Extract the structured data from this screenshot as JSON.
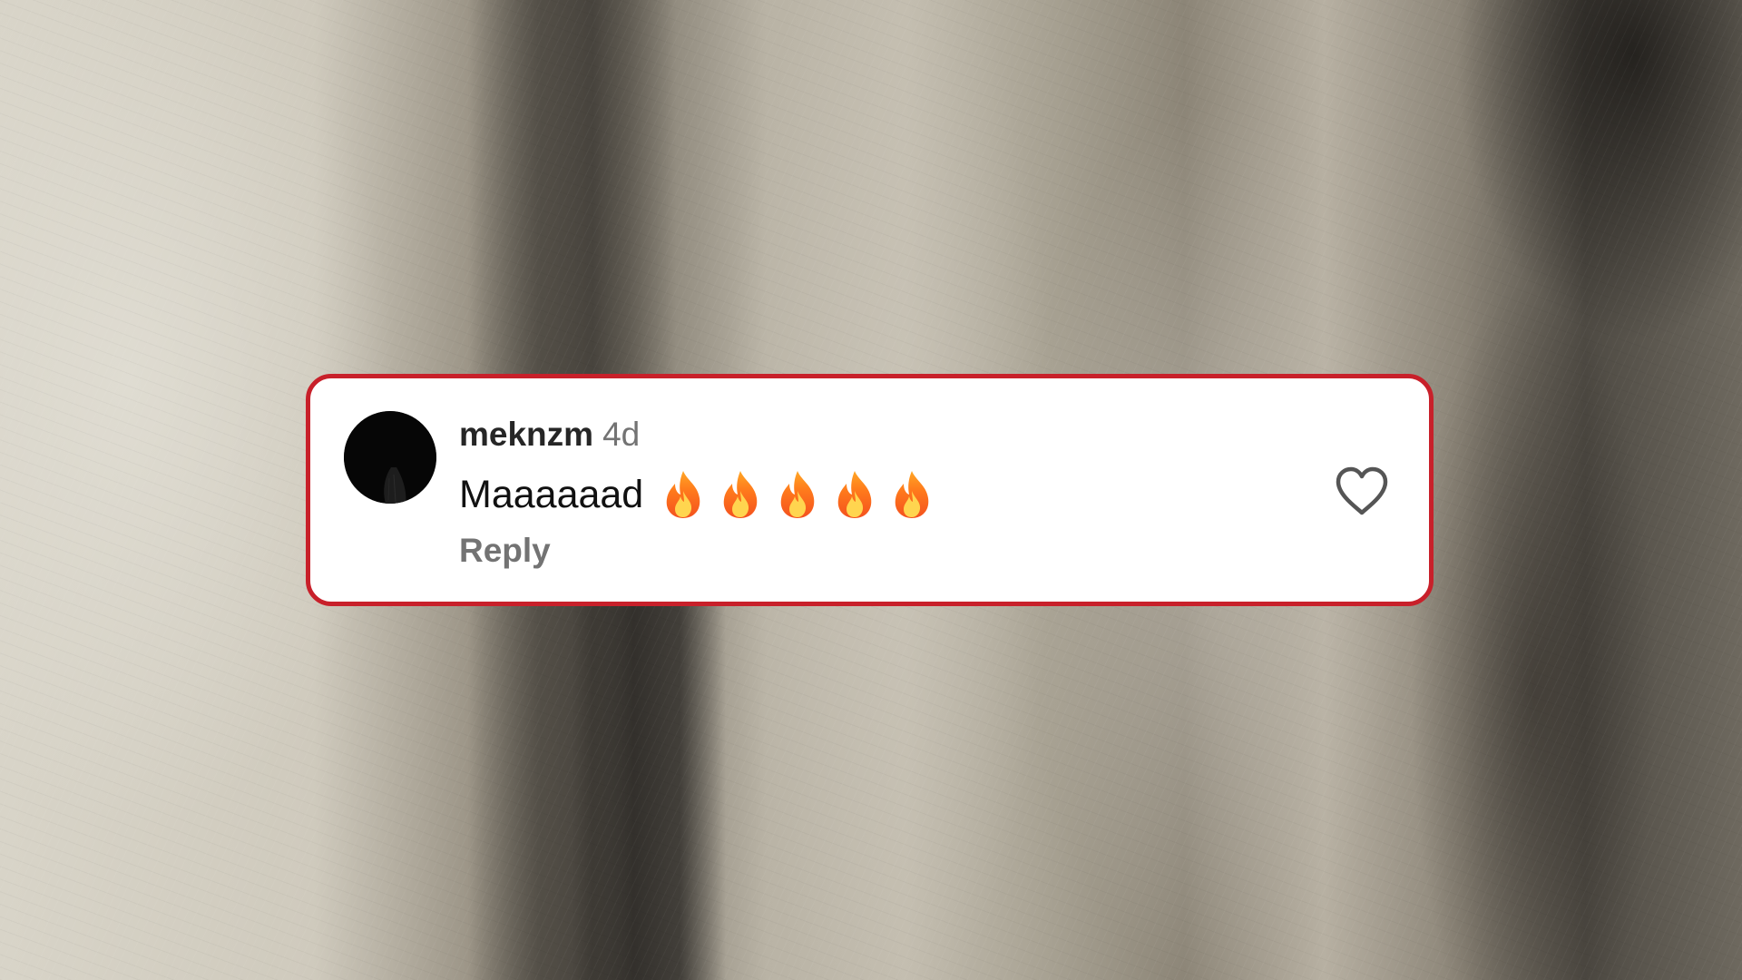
{
  "comment": {
    "username": "meknzm",
    "timestamp": "4d",
    "text": "Maaaaaad",
    "emoji_icon": "fire-emoji",
    "emoji_count": 5,
    "reply_label": "Reply",
    "like_icon": "heart-outline-icon"
  },
  "colors": {
    "card_border": "#c8202a",
    "card_background": "#ffffff",
    "username": "#262626",
    "secondary_text": "#737373"
  }
}
